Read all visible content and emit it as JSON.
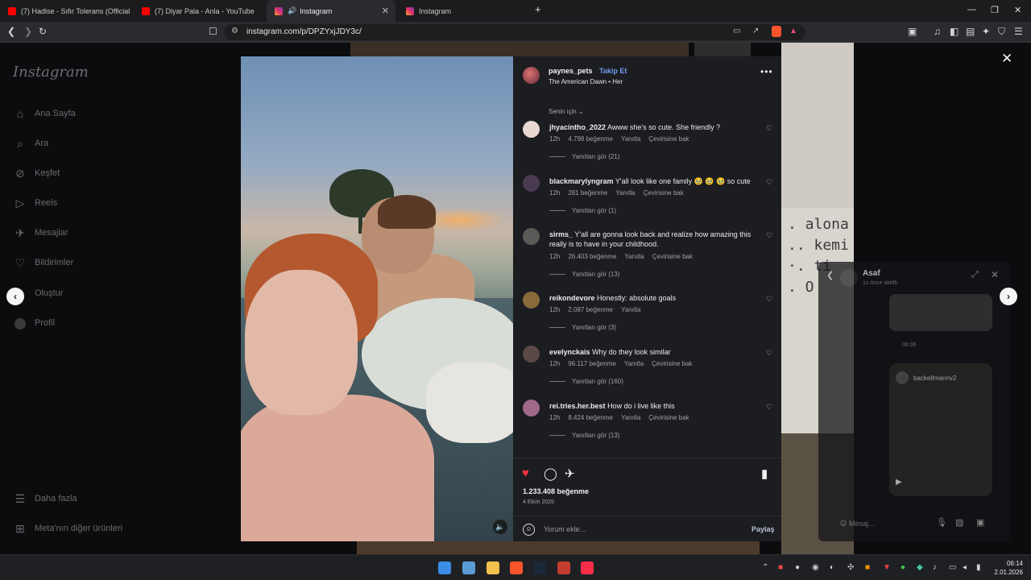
{
  "browser": {
    "tabs": [
      {
        "title": "(7) Hadise - Sıfır Tolerans (Official Vid",
        "active": false
      },
      {
        "title": "(7) Diyar Pala - Anla - YouTube",
        "active": false
      },
      {
        "title": "Instagram",
        "active": true
      },
      {
        "title": "Instagram",
        "active": false
      }
    ],
    "new_tab": "+",
    "url": "instagram.com/p/DPZYxjJDY3c/"
  },
  "sidebar": {
    "logo": "Instagram",
    "items": [
      {
        "label": "Ana Sayfa",
        "icon": "home-icon"
      },
      {
        "label": "Ara",
        "icon": "search-icon"
      },
      {
        "label": "Keşfet",
        "icon": "compass-icon"
      },
      {
        "label": "Reels",
        "icon": "reels-icon"
      },
      {
        "label": "Mesajlar",
        "icon": "messages-icon"
      },
      {
        "label": "Bildirimler",
        "icon": "heart-icon"
      },
      {
        "label": "Oluştur",
        "icon": "plus-icon"
      },
      {
        "label": "Profil",
        "icon": "avatar-icon"
      }
    ],
    "more": "Daha fazla",
    "meta": "Meta'nın diğer ürünleri"
  },
  "post": {
    "username": "paynes_pets",
    "follow_label": "Takip Et",
    "subtitle": "The American Dawn • Her",
    "sort_label": "Senin için",
    "comments": [
      {
        "user": "jhyacintho_2022",
        "text": "Awww she's so cute. She friendly ?",
        "time": "12h",
        "likes": "4.798 beğenme",
        "reply": "Yanıtla",
        "translate": "Çevirisine bak",
        "replies": "Yanıtları gör (21)",
        "avatar_color": "#e9d7d2"
      },
      {
        "user": "blackmarylyngram",
        "text": "Y'all look like one family 🥹 🥹 🥹 so cute",
        "time": "12h",
        "likes": "281 beğenme",
        "reply": "Yanıtla",
        "translate": "Çevirisine bak",
        "replies": "Yanıtları gör (1)",
        "avatar_color": "#4a3b52"
      },
      {
        "user": "sirms_",
        "text": "Y'all are gonna look back and realize how amazing this really is to have in your childhood.",
        "time": "12h",
        "likes": "26.403 beğenme",
        "reply": "Yanıtla",
        "translate": "Çevirisine bak",
        "replies": "Yanıtları gör (13)",
        "avatar_color": "#5c5a58"
      },
      {
        "user": "reikondevore",
        "text": "Honestly: absolute goals",
        "time": "12h",
        "likes": "2.087 beğenme",
        "reply": "Yanıtla",
        "translate": "",
        "replies": "Yanıtları gör (3)",
        "avatar_color": "#8a6a3a"
      },
      {
        "user": "evelynckais",
        "text": "Why do they look similar",
        "time": "12h",
        "likes": "96.117 beğenme",
        "reply": "Yanıtla",
        "translate": "Çevirisine bak",
        "replies": "Yanıtları gör (160)",
        "avatar_color": "#5a4a46"
      },
      {
        "user": "rei.tries.her.best",
        "text": "How do i live like this",
        "time": "12h",
        "likes": "8.424 beğenme",
        "reply": "Yanıtla",
        "translate": "Çevirisine bak",
        "replies": "Yanıtları gör (13)",
        "avatar_color": "#a0688a"
      }
    ],
    "likes_total": "1.233.408 beğenme",
    "date": "4 Ekim 2025",
    "comment_placeholder": "Yorum ekle...",
    "share_label": "Paylaş"
  },
  "background": {
    "paper_lines": [
      ". alona",
      ".. kemi",
      "·. ti",
      ". O"
    ]
  },
  "chat": {
    "name": "Asaf",
    "status": "1s önce aktifti",
    "time": "06:06",
    "shared_user": "backellmannv2",
    "message_placeholder": "Mesaj..."
  },
  "taskbar": {
    "time": "06:14",
    "date": "2.01.2026"
  },
  "colors": {
    "accent": "#6f9bf5",
    "like_red": "#ff3040"
  }
}
